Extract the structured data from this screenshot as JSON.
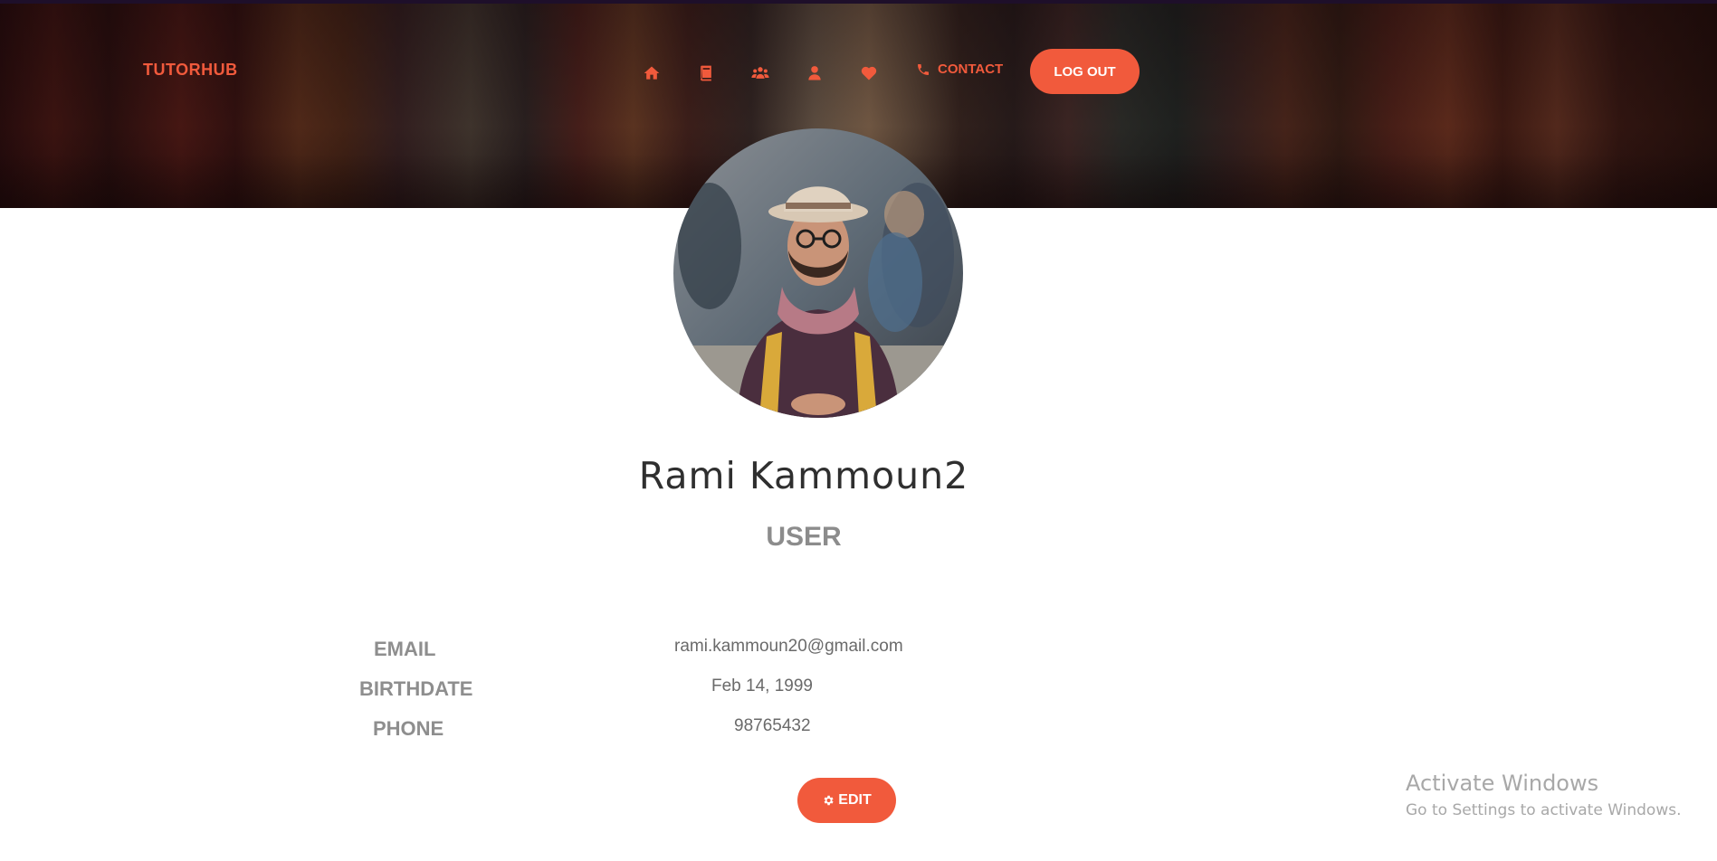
{
  "header": {
    "brand": "TUTORHUB",
    "nav_icons": [
      "home-icon",
      "book-icon",
      "users-icon",
      "user-icon",
      "heart-icon"
    ],
    "contact_label": "CONTACT",
    "logout_label": "LOG OUT"
  },
  "profile": {
    "full_name": "Rami Kammoun2",
    "role": "USER",
    "fields": [
      {
        "label": "EMAIL",
        "value": "rami.kammoun20@gmail.com"
      },
      {
        "label": "BIRTHDATE",
        "value": "Feb 14, 1999"
      },
      {
        "label": "PHONE",
        "value": "98765432"
      }
    ],
    "edit_label": "EDIT"
  },
  "watermark": {
    "title": "Activate Windows",
    "subtitle": "Go to Settings to activate Windows."
  },
  "colors": {
    "accent": "#f15a3c",
    "label_gray": "#8e8e8e",
    "name_color": "#2f2f2f"
  }
}
